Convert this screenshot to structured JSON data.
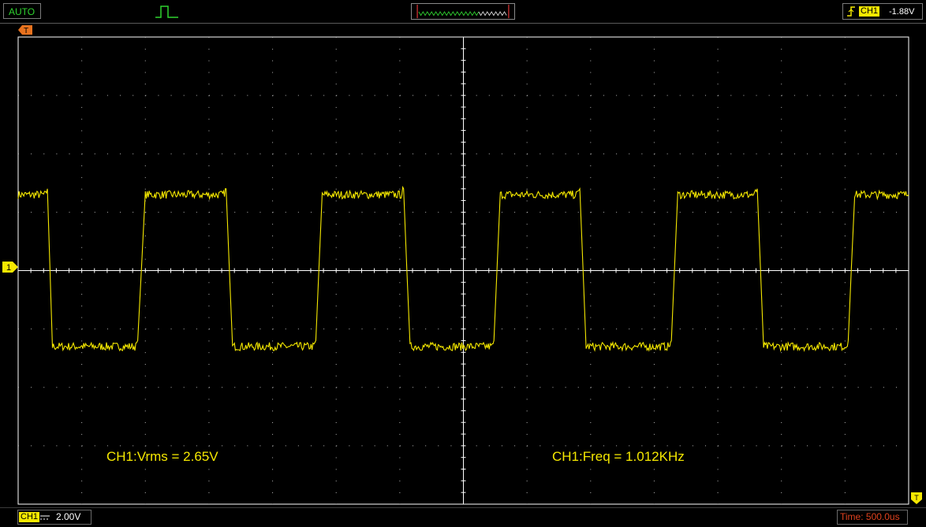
{
  "status": {
    "mode": "AUTO",
    "trigger_channel": "CH1",
    "trigger_level": "-1.88V",
    "trigger_mode_icon": "single-pulse-icon",
    "trigger_edge_icon": "rising-edge-icon"
  },
  "markers": {
    "trigger_time": "T",
    "channel": "1",
    "trigger_level": "T"
  },
  "measurements": {
    "vrms": "CH1:Vrms = 2.65V",
    "freq": "CH1:Freq = 1.012KHz"
  },
  "channel": {
    "name": "CH1",
    "volts_per_div": "2.00V",
    "coupling_icon": "dc-coupling-icon"
  },
  "timebase": {
    "label": "Time: 500.0us"
  },
  "colors": {
    "trace": "#f5e800",
    "mode": "#2fd32f",
    "time": "#e0421e",
    "grid": "#b4b4b4"
  },
  "chart_data": {
    "type": "line",
    "title": "",
    "xlabel": "",
    "ylabel": "",
    "x_divisions": 14,
    "y_divisions": 8,
    "series": [
      {
        "x_div": [
          0.0,
          0.43,
          0.46,
          0.54,
          1.85,
          1.88,
          2.0,
          3.23,
          3.27,
          3.37,
          4.65,
          4.68,
          4.78,
          6.02,
          6.06,
          6.16,
          7.45,
          7.48,
          7.58,
          8.79,
          8.83,
          8.93,
          10.23,
          10.27,
          10.37,
          11.58,
          11.62,
          11.72,
          13.01,
          13.05,
          13.15,
          14.0
        ],
        "y_div": [
          1.3,
          1.3,
          1.4,
          -1.3,
          -1.3,
          -1.2,
          1.3,
          1.3,
          1.4,
          -1.3,
          -1.3,
          -1.2,
          1.3,
          1.3,
          1.4,
          -1.3,
          -1.3,
          -1.2,
          1.3,
          1.3,
          1.4,
          -1.3,
          -1.3,
          -1.2,
          1.3,
          1.3,
          1.4,
          -1.3,
          -1.3,
          -1.2,
          1.3,
          1.3
        ]
      }
    ]
  }
}
